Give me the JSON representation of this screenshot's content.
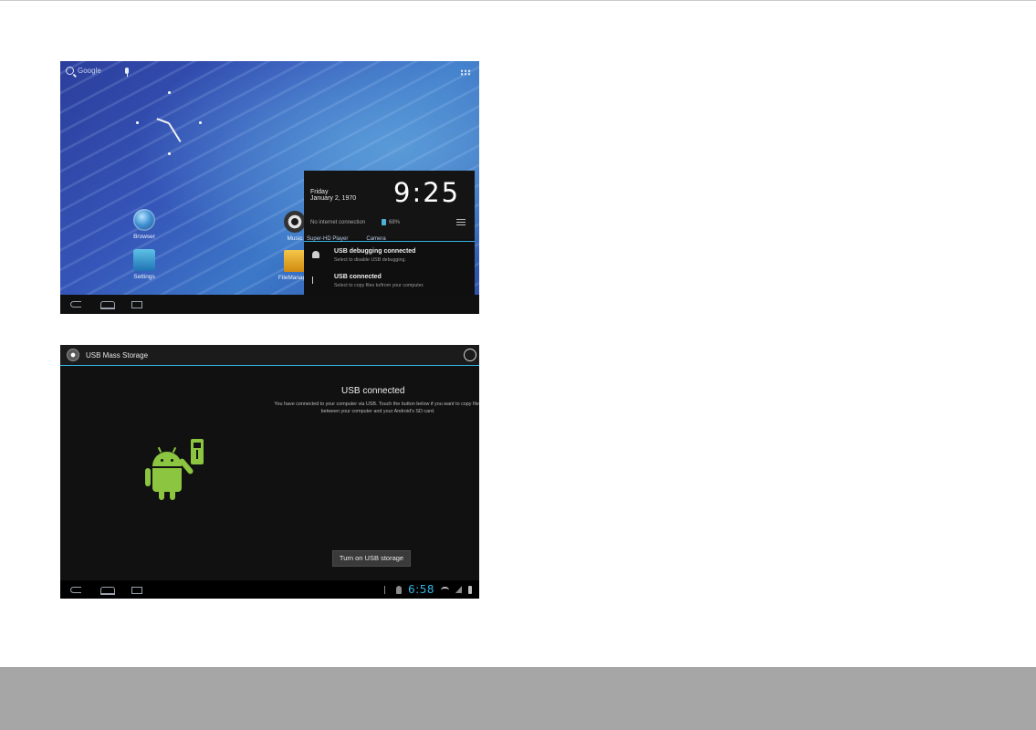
{
  "screen1": {
    "search_label": "Google",
    "apps": [
      {
        "name": "Browser"
      },
      {
        "name": "Settings"
      },
      {
        "name": "Music"
      },
      {
        "name": "FileManager"
      }
    ],
    "behind_labels": [
      "Super-HD Player",
      "Camera"
    ],
    "notification_panel": {
      "day": "Friday",
      "date": "January 2, 1970",
      "time": "9:25",
      "network": "No internet connection",
      "battery": "68%",
      "items": [
        {
          "title": "USB debugging connected",
          "subtitle": "Select to disable USB debugging."
        },
        {
          "title": "USB connected",
          "subtitle": "Select to copy files to/from your computer."
        }
      ]
    }
  },
  "screen2": {
    "title": "USB Mass Storage",
    "heading": "USB connected",
    "description": "You have connected to your computer via USB. Touch the button below if you want to copy files between your computer and your Android's SD card.",
    "button_label": "Turn on USB storage",
    "status_time": "6:58"
  },
  "colors": {
    "accent": "#33b5e5",
    "android_green": "#8cc540",
    "footer_band": "#a7a6a6"
  }
}
